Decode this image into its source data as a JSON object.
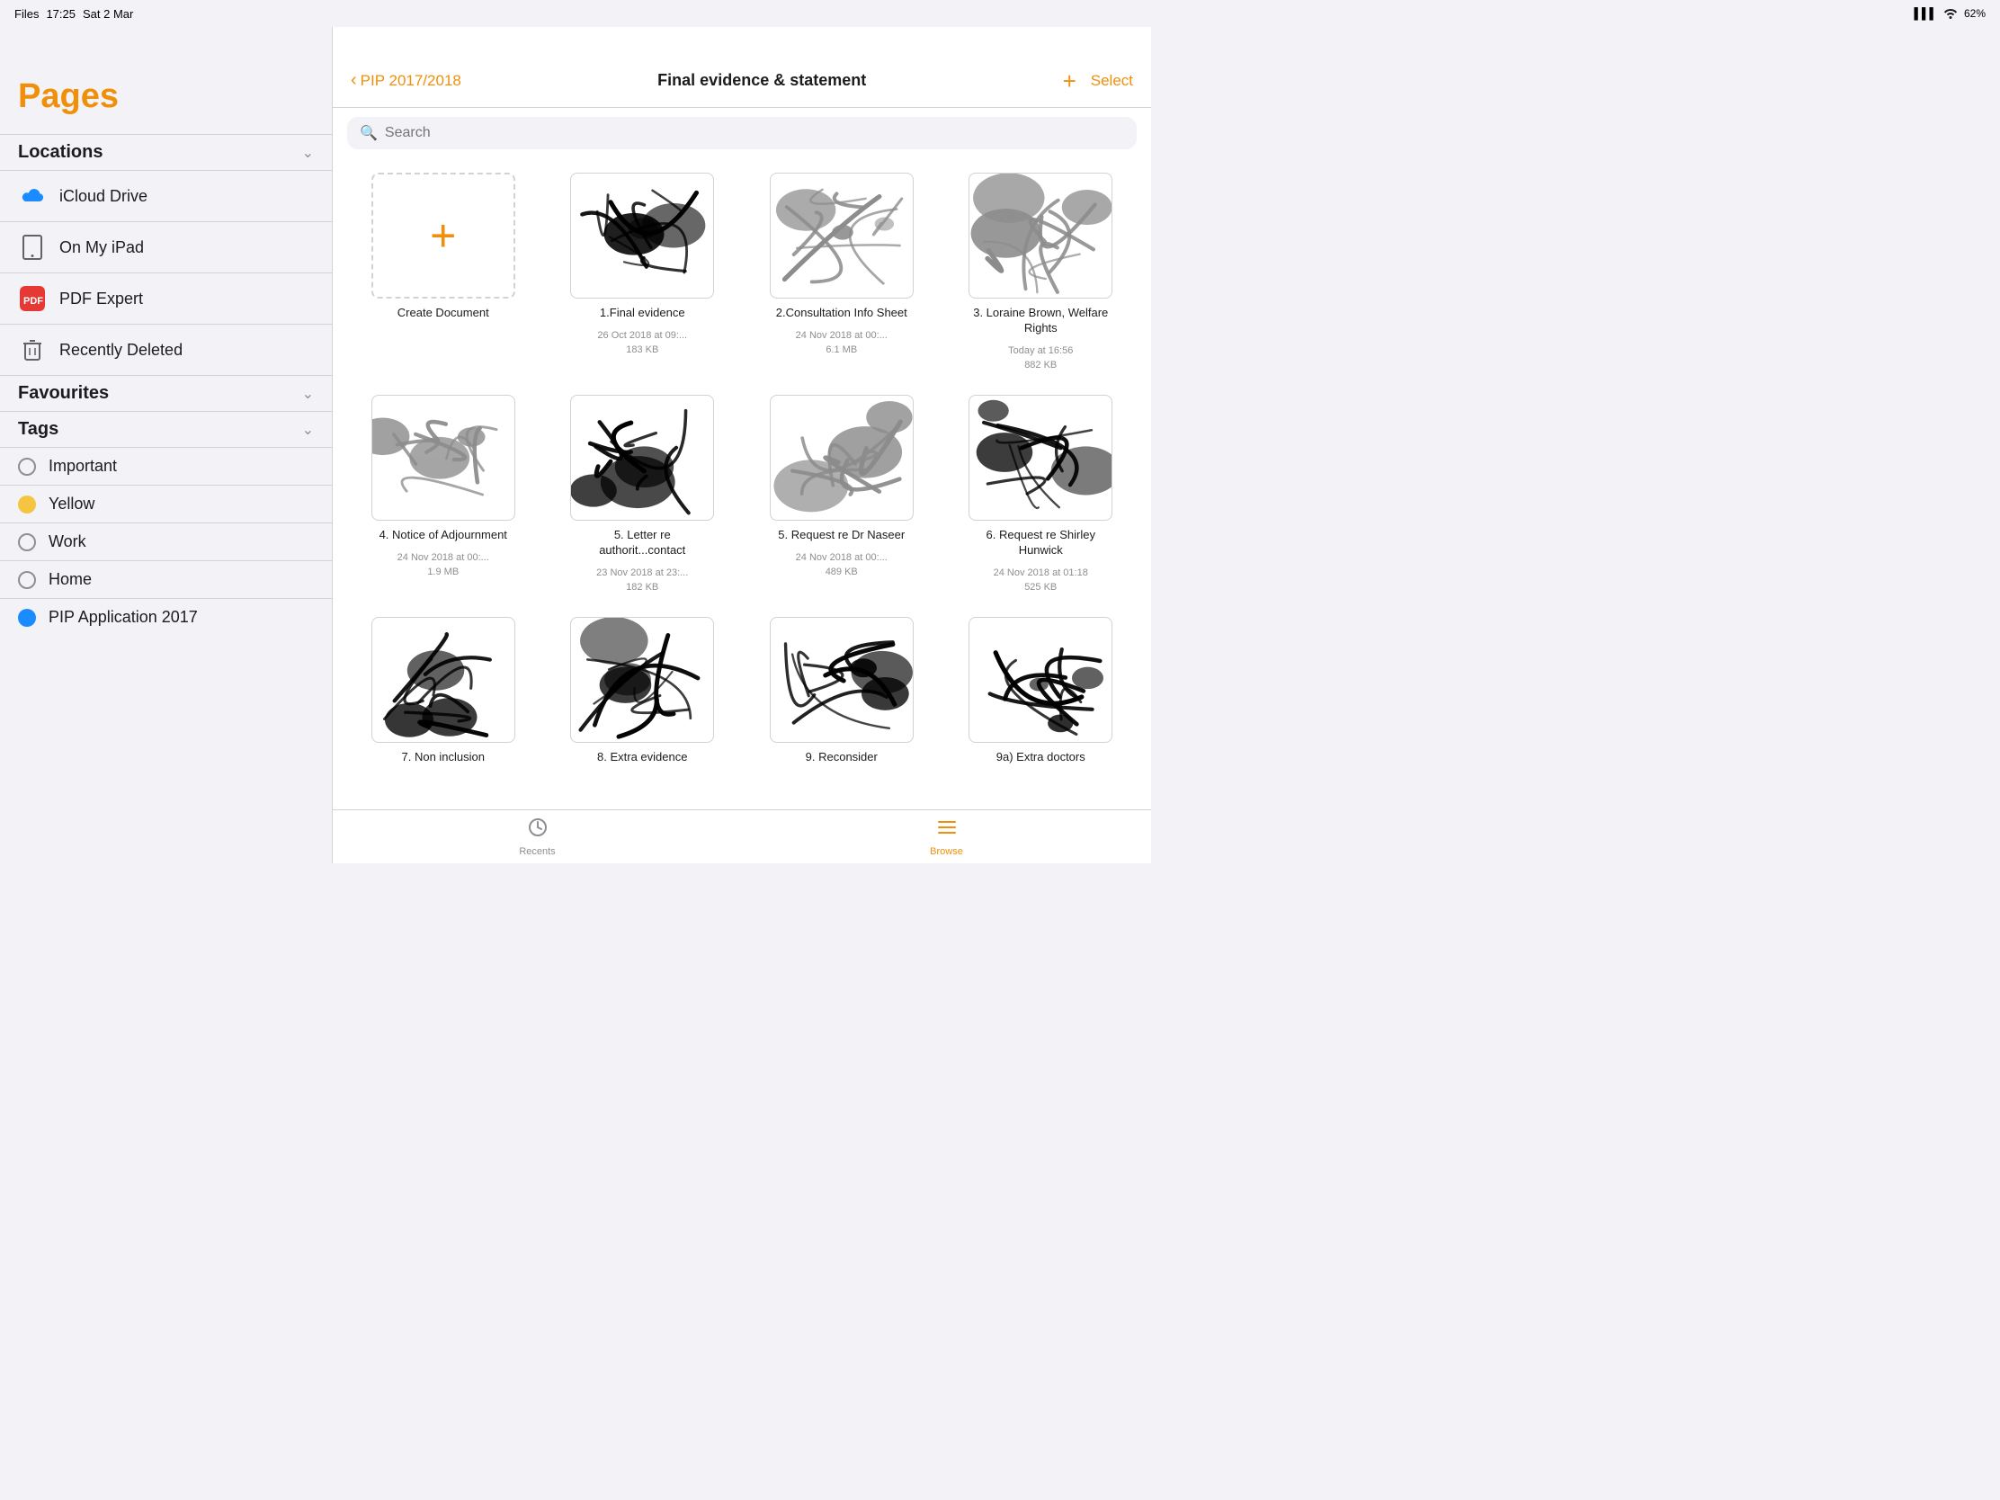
{
  "statusBar": {
    "appLabel": "Files",
    "time": "17:25",
    "date": "Sat 2 Mar",
    "signal": "▌▌▌▍",
    "wifi": "WiFi",
    "battery": "62%"
  },
  "sidebar": {
    "title": "Pages",
    "sections": {
      "locations": {
        "label": "Locations",
        "items": [
          {
            "id": "icloud",
            "label": "iCloud Drive",
            "icon": "icloud"
          },
          {
            "id": "ipad",
            "label": "On My iPad",
            "icon": "ipad"
          },
          {
            "id": "pdf",
            "label": "PDF Expert",
            "icon": "pdf"
          },
          {
            "id": "trash",
            "label": "Recently Deleted",
            "icon": "trash"
          }
        ]
      },
      "favourites": {
        "label": "Favourites"
      },
      "tags": {
        "label": "Tags",
        "items": [
          {
            "id": "important",
            "label": "Important",
            "color": "none"
          },
          {
            "id": "yellow",
            "label": "Yellow",
            "color": "yellow"
          },
          {
            "id": "work",
            "label": "Work",
            "color": "none"
          },
          {
            "id": "home",
            "label": "Home",
            "color": "none"
          },
          {
            "id": "pip",
            "label": "PIP Application 2017",
            "color": "blue"
          }
        ]
      }
    }
  },
  "navBar": {
    "backLabel": "PIP 2017/2018",
    "title": "Final evidence & statement",
    "plusLabel": "+",
    "selectLabel": "Select"
  },
  "search": {
    "placeholder": "Search"
  },
  "files": [
    {
      "id": "create",
      "name": "Create Document",
      "type": "create"
    },
    {
      "id": "file1",
      "name": "1.Final evidence",
      "meta": "26 Oct 2018 at 09:...\n183 KB",
      "type": "doc"
    },
    {
      "id": "file2",
      "name": "2.Consultation Info Sheet",
      "meta": "24 Nov 2018 at 00:...\n6.1 MB",
      "type": "doc",
      "faded": true
    },
    {
      "id": "file3",
      "name": "3. Loraine Brown, Welfare Rights",
      "meta": "Today at 16:56\n882 KB",
      "type": "doc",
      "faded": true
    },
    {
      "id": "file4",
      "name": "4. Notice of Adjournment",
      "meta": "24 Nov 2018 at 00:...\n1.9 MB",
      "type": "doc",
      "faded": true
    },
    {
      "id": "file5a",
      "name": "5. Letter re authorit...contact",
      "meta": "23 Nov 2018 at 23:...\n182 KB",
      "type": "doc"
    },
    {
      "id": "file5b",
      "name": "5. Request re Dr Naseer",
      "meta": "24 Nov 2018 at 00:...\n489 KB",
      "type": "doc",
      "faded": true
    },
    {
      "id": "file6",
      "name": "6. Request re Shirley Hunwick",
      "meta": "24 Nov 2018 at 01:18\n525 KB",
      "type": "doc"
    },
    {
      "id": "file7",
      "name": "7. Non inclusion",
      "meta": "",
      "type": "doc"
    },
    {
      "id": "file8",
      "name": "8. Extra evidence",
      "meta": "",
      "type": "doc"
    },
    {
      "id": "file9a",
      "name": "9. Reconsider",
      "meta": "",
      "type": "doc"
    },
    {
      "id": "file9b",
      "name": "9a) Extra doctors",
      "meta": "",
      "type": "doc"
    }
  ],
  "tabBar": {
    "recentsLabel": "Recents",
    "browseLabel": "Browse"
  }
}
